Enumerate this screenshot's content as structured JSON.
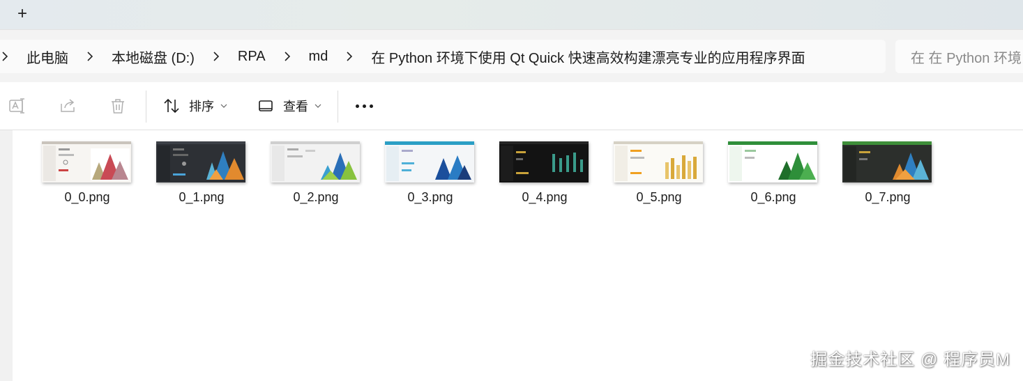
{
  "tabstrip": {
    "new_tab_label": "+"
  },
  "breadcrumb": {
    "items": [
      "此电脑",
      "本地磁盘 (D:)",
      "RPA",
      "md",
      "在 Python 环境下使用 Qt Quick 快速高效构建漂亮专业的应用程序界面"
    ]
  },
  "search": {
    "placeholder": "在 在 Python 环境"
  },
  "toolbar": {
    "sort_label": "排序",
    "view_label": "查看"
  },
  "files": [
    {
      "name": "0_0.png",
      "theme": "light-red"
    },
    {
      "name": "0_1.png",
      "theme": "dark-orange"
    },
    {
      "name": "0_2.png",
      "theme": "light-green"
    },
    {
      "name": "0_3.png",
      "theme": "light-teal"
    },
    {
      "name": "0_4.png",
      "theme": "black-teal"
    },
    {
      "name": "0_5.png",
      "theme": "light-gold"
    },
    {
      "name": "0_6.png",
      "theme": "white-green"
    },
    {
      "name": "0_7.png",
      "theme": "dark-green"
    }
  ],
  "watermark": "掘金技术社区 @ 程序员M",
  "colors": {
    "accent": "#1e6fd6",
    "tabstrip": "#e4eaee",
    "address_bg": "#f3f3f3"
  }
}
